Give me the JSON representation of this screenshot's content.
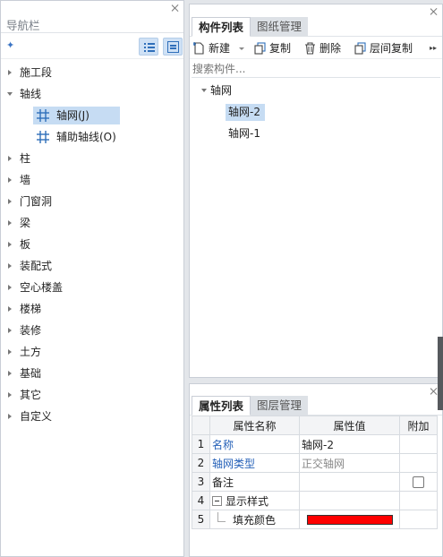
{
  "nav": {
    "title": "导航栏",
    "items": [
      {
        "label": "施工段",
        "expanded": false
      },
      {
        "label": "轴线",
        "expanded": true,
        "children": [
          {
            "label": "轴网(J)",
            "selected": true
          },
          {
            "label": "辅助轴线(O)",
            "selected": false
          }
        ]
      },
      {
        "label": "柱"
      },
      {
        "label": "墙"
      },
      {
        "label": "门窗洞"
      },
      {
        "label": "梁"
      },
      {
        "label": "板"
      },
      {
        "label": "装配式"
      },
      {
        "label": "空心楼盖"
      },
      {
        "label": "楼梯"
      },
      {
        "label": "装修"
      },
      {
        "label": "土方"
      },
      {
        "label": "基础"
      },
      {
        "label": "其它"
      },
      {
        "label": "自定义"
      }
    ]
  },
  "components": {
    "tabs": [
      "构件列表",
      "图纸管理"
    ],
    "toolbar": {
      "new": "新建",
      "copy": "复制",
      "delete": "删除",
      "floor_copy": "层间复制"
    },
    "search_placeholder": "搜索构件...",
    "tree": {
      "root": "轴网",
      "items": [
        "轴网-2",
        "轴网-1"
      ]
    }
  },
  "properties": {
    "tabs": [
      "属性列表",
      "图层管理"
    ],
    "headers": [
      "属性名称",
      "属性值",
      "附加"
    ],
    "rows": [
      {
        "idx": "1",
        "name": "名称",
        "value": "轴网-2"
      },
      {
        "idx": "2",
        "name": "轴网类型",
        "value": "正交轴网"
      },
      {
        "idx": "3",
        "name": "备注",
        "value": ""
      },
      {
        "idx": "4",
        "name": "显示样式",
        "value": ""
      },
      {
        "idx": "5",
        "name": "填充颜色",
        "value": ""
      }
    ],
    "fill_color": "#ff0000"
  },
  "colors": {
    "accent": "#2561b8",
    "selection": "#c6dcf3"
  }
}
